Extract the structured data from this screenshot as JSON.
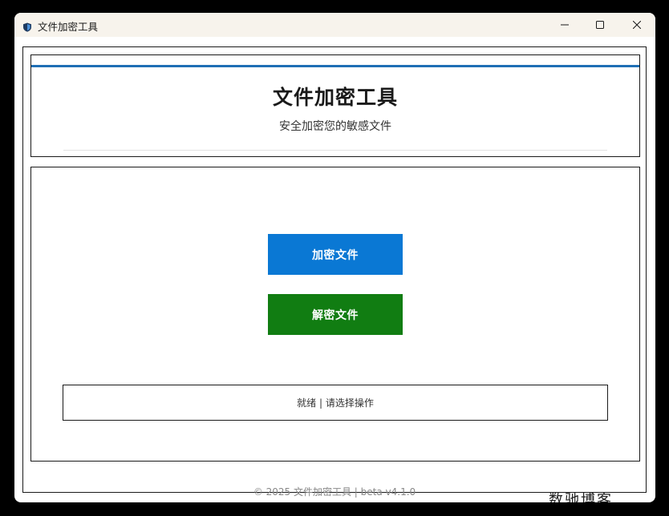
{
  "window": {
    "title": "文件加密工具",
    "icon": "shield-icon",
    "controls": {
      "minimize_icon": "minimize-icon",
      "maximize_icon": "maximize-icon",
      "close_icon": "close-icon"
    }
  },
  "header": {
    "title": "文件加密工具",
    "subtitle": "安全加密您的敏感文件",
    "accent_color": "#1f6fb5"
  },
  "actions": {
    "encrypt_label": "加密文件",
    "decrypt_label": "解密文件",
    "encrypt_color": "#0a78d4",
    "decrypt_color": "#117d12"
  },
  "status": {
    "text": "就绪 | 请选择操作"
  },
  "footer": {
    "text": "© 2025 文件加密工具 | beta v4.1.0"
  },
  "watermark": {
    "text": "数驰博客"
  }
}
